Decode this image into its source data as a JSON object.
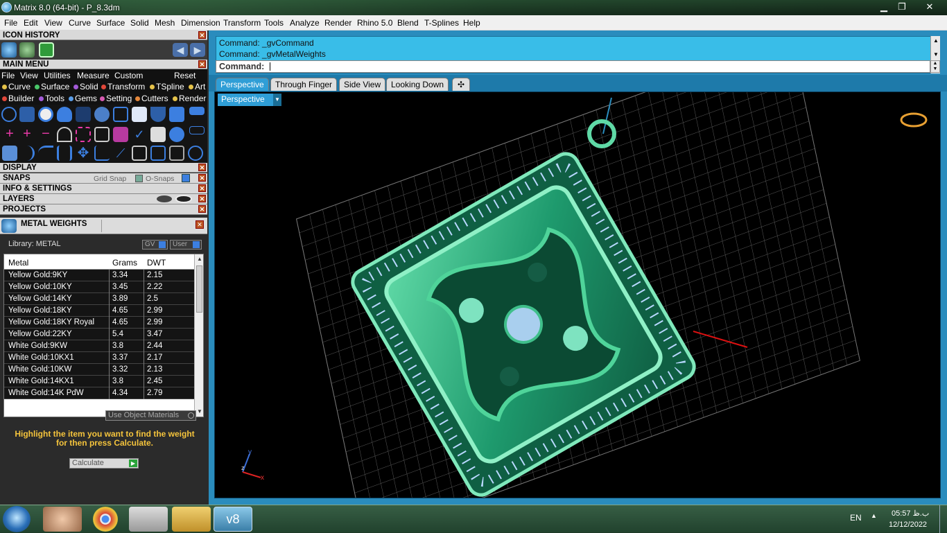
{
  "window": {
    "title": "Matrix 8.0 (64-bit) - P_8.3dm",
    "min": "▁",
    "max": "❐",
    "close": "✕"
  },
  "menubar": [
    "File",
    "Edit",
    "View",
    "Curve",
    "Surface",
    "Solid",
    "Mesh",
    "Dimension",
    "Transform",
    "Tools",
    "Analyze",
    "Render",
    "Rhino 5.0",
    "Blend",
    "T-Splines",
    "Help"
  ],
  "panels": {
    "icon_history": "ICON HISTORY",
    "main_menu": "MAIN MENU",
    "main_menu_items": [
      "File",
      "View",
      "Utilities",
      "Measure",
      "Custom",
      "Reset"
    ],
    "tools_row1": [
      "Curve",
      "Surface",
      "Solid",
      "Transform",
      "TSpline",
      "Art"
    ],
    "tools_row2": [
      "Builder",
      "Tools",
      "Gems",
      "Setting",
      "Cutters",
      "Render"
    ],
    "display": "DISPLAY",
    "snaps": "SNAPS",
    "grid_snap": "Grid Snap",
    "o_snaps": "O-Snaps",
    "info_settings": "INFO & SETTINGS",
    "layers": "LAYERS",
    "projects": "PROJECTS",
    "close_glyph": "✕"
  },
  "metal_weights": {
    "title": "METAL WEIGHTS",
    "library": "Library: METAL",
    "gv": "GV",
    "user": "User",
    "columns": [
      "Metal",
      "Grams",
      "DWT"
    ],
    "rows": [
      [
        "Yellow Gold:9KY",
        "3.34",
        "2.15"
      ],
      [
        "Yellow Gold:10KY",
        "3.45",
        "2.22"
      ],
      [
        "Yellow Gold:14KY",
        "3.89",
        "2.5"
      ],
      [
        "Yellow Gold:18KY",
        "4.65",
        "2.99"
      ],
      [
        "Yellow Gold:18KY Royal",
        "4.65",
        "2.99"
      ],
      [
        "Yellow Gold:22KY",
        "5.4",
        "3.47"
      ],
      [
        "White Gold:9KW",
        "3.8",
        "2.44"
      ],
      [
        "White Gold:10KX1",
        "3.37",
        "2.17"
      ],
      [
        "White Gold:10KW",
        "3.32",
        "2.13"
      ],
      [
        "White Gold:14KX1",
        "3.8",
        "2.45"
      ],
      [
        "White Gold:14K PdW",
        "4.34",
        "2.79"
      ]
    ],
    "use_object_materials": "Use Object Materials",
    "hint": "Highlight the item you want to find the weight for then press Calculate.",
    "calculate": "Calculate"
  },
  "command": {
    "line1": "Command: _gvCommand",
    "line2": "Command: _gvMetalWeights",
    "prompt": "Command:"
  },
  "tabs": [
    "Perspective",
    "Through Finger",
    "Side View",
    "Looking Down"
  ],
  "tab_add": "✣",
  "viewport": {
    "label": "Perspective",
    "dropdown": "▼",
    "axis_y": "y",
    "axis_x": "x",
    "axis_z": "z"
  },
  "taskbar": {
    "lang": "EN",
    "time": "05:57 ب.ظ",
    "date": "12/12/2022"
  },
  "colors": {
    "accent": "#2f9ed6",
    "model": "#1fa77a",
    "gem": "#b8d8ff"
  }
}
